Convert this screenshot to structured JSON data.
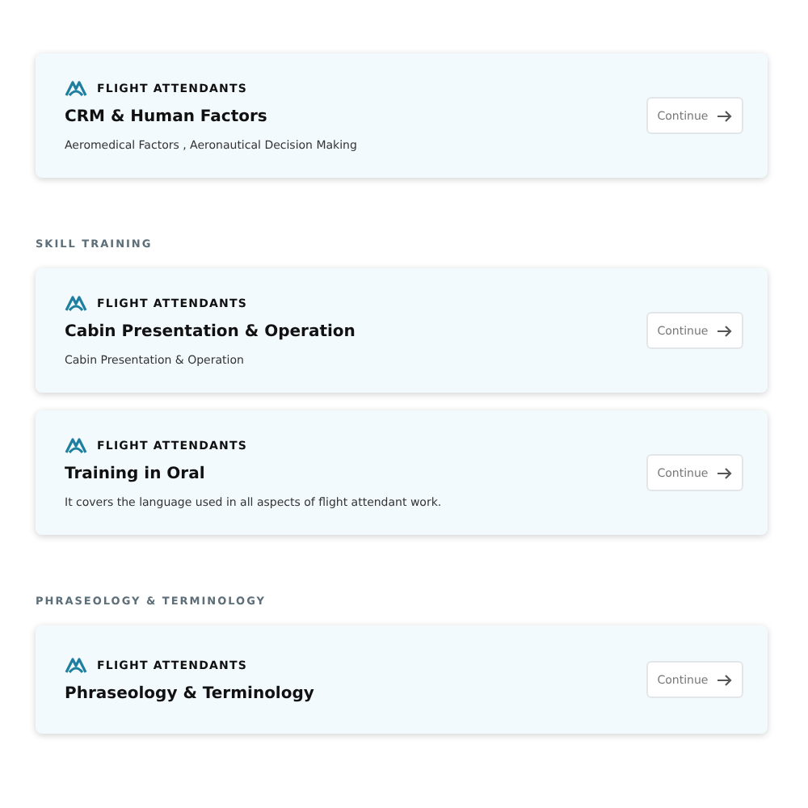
{
  "sections": [
    {
      "courses": [
        {
          "category": "FLIGHT ATTENDANTS",
          "title": "CRM & Human Factors",
          "description": "Aeromedical Factors , Aeronautical Decision Making",
          "button": "Continue"
        }
      ]
    },
    {
      "heading": "SKILL TRAINING",
      "courses": [
        {
          "category": "FLIGHT ATTENDANTS",
          "title": "Cabin Presentation & Operation",
          "description": "Cabin Presentation & Operation",
          "button": "Continue"
        },
        {
          "category": "FLIGHT ATTENDANTS",
          "title": "Training in Oral",
          "description": "It covers the language used in all aspects of flight attendant work.",
          "button": "Continue"
        }
      ]
    },
    {
      "heading": "PHRASEOLOGY & TERMINOLOGY",
      "courses": [
        {
          "category": "FLIGHT ATTENDANTS",
          "title": "Phraseology & Terminology",
          "button": "Continue"
        }
      ]
    }
  ]
}
